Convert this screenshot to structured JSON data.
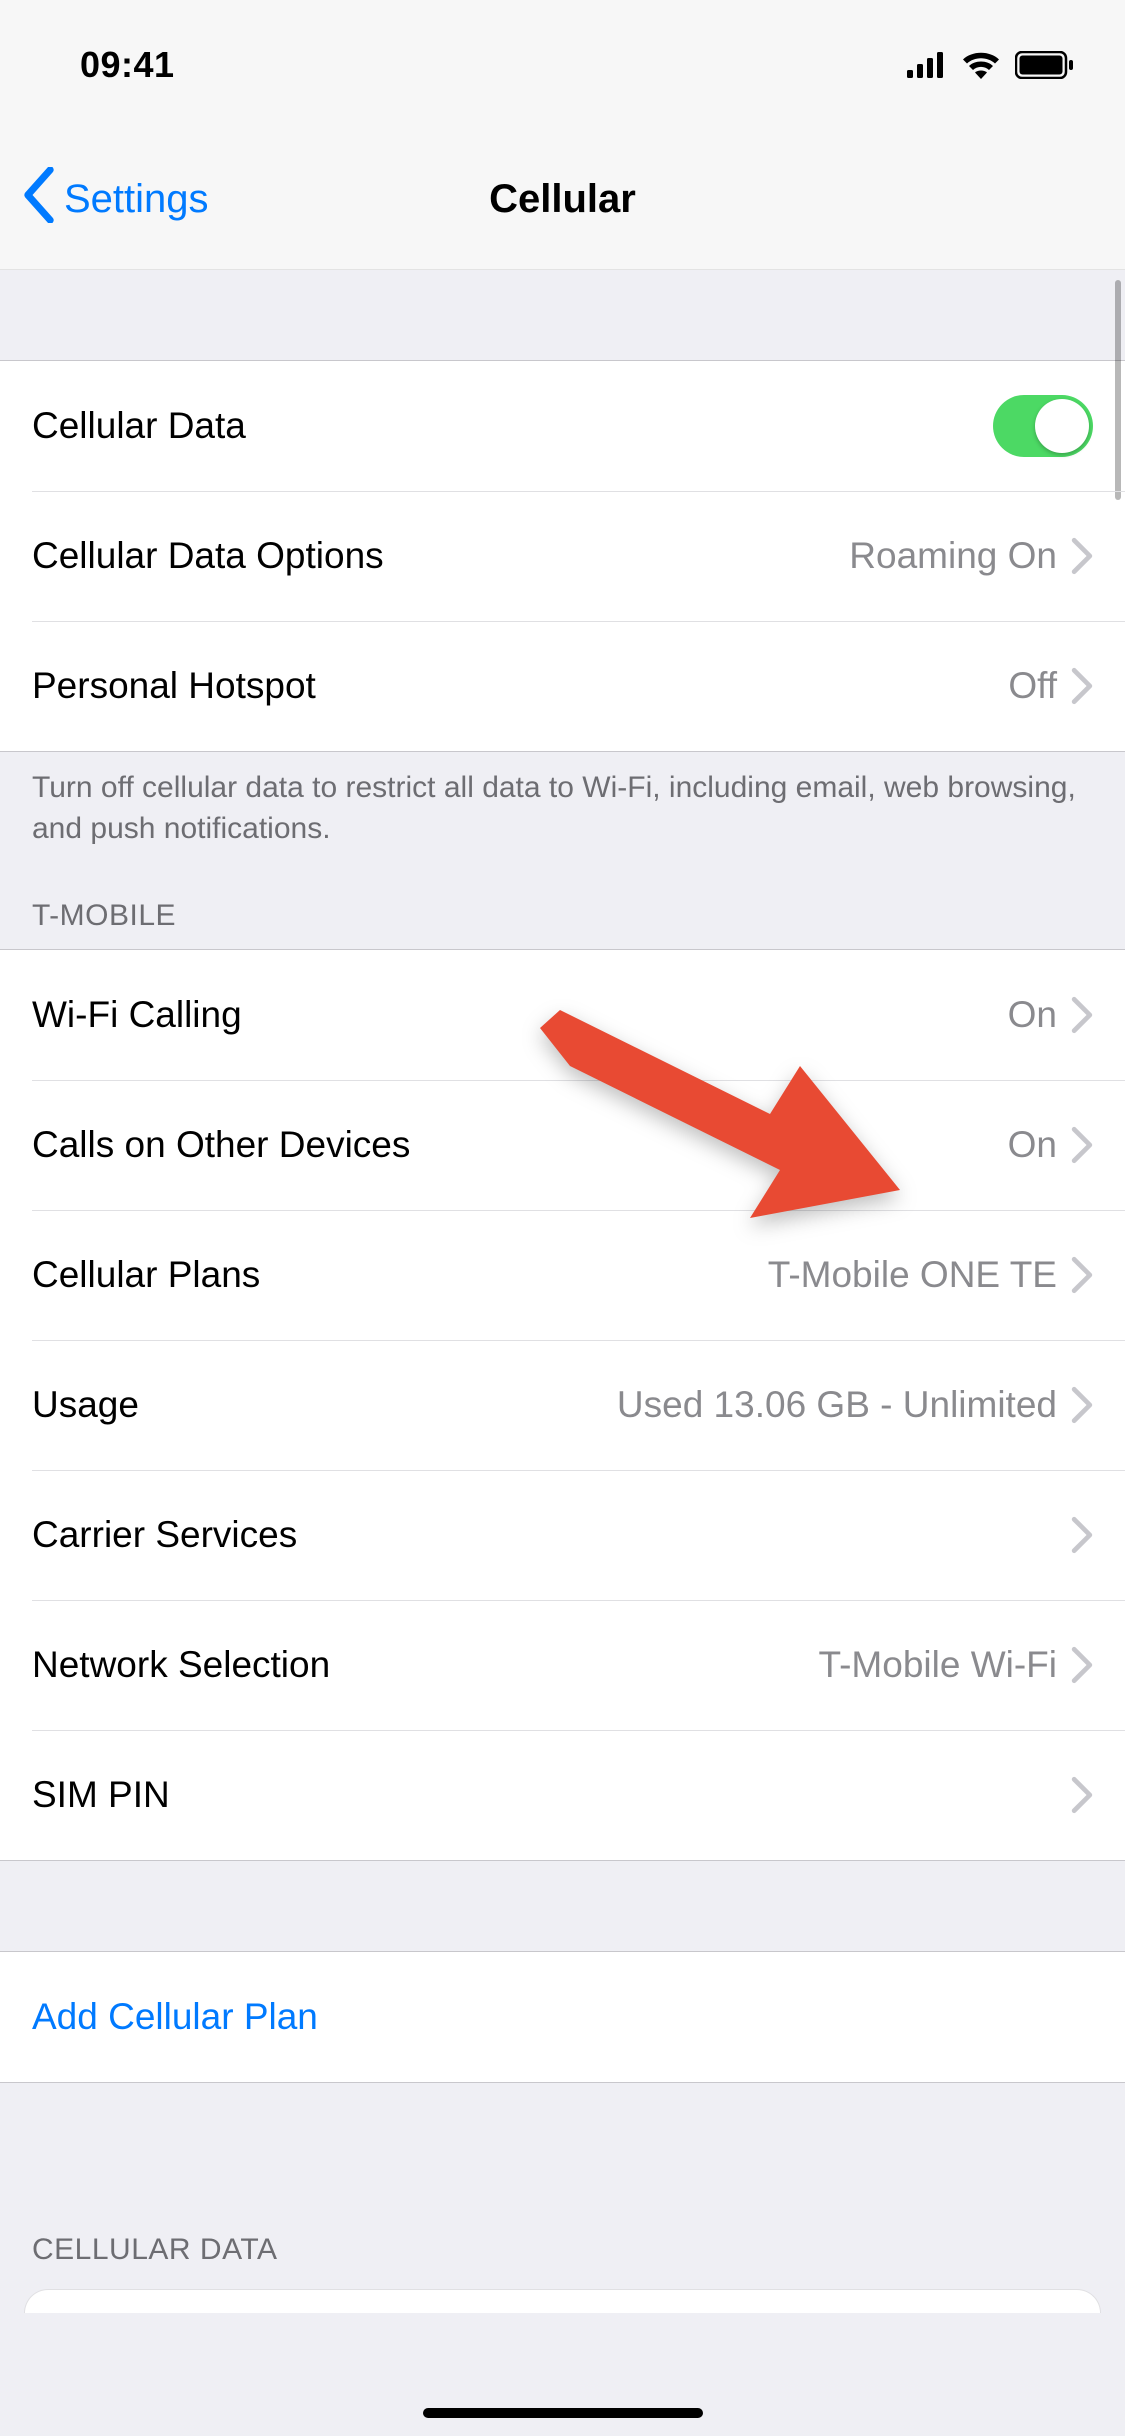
{
  "status": {
    "time": "09:41"
  },
  "nav": {
    "back": "Settings",
    "title": "Cellular"
  },
  "section1": {
    "cellular_data_label": "Cellular Data",
    "cellular_data_on": true,
    "options_label": "Cellular Data Options",
    "options_value": "Roaming On",
    "hotspot_label": "Personal Hotspot",
    "hotspot_value": "Off",
    "footer": "Turn off cellular data to restrict all data to Wi-Fi, including email, web browsing, and push notifications."
  },
  "section2": {
    "header": "T-MOBILE",
    "wifi_calling_label": "Wi-Fi Calling",
    "wifi_calling_value": "On",
    "calls_other_label": "Calls on Other Devices",
    "calls_other_value": "On",
    "plans_label": "Cellular Plans",
    "plans_value": "T-Mobile ONE TE",
    "usage_label": "Usage",
    "usage_value": "Used 13.06 GB - Unlimited",
    "carrier_label": "Carrier Services",
    "network_label": "Network Selection",
    "network_value": "T-Mobile Wi-Fi",
    "sim_pin_label": "SIM PIN"
  },
  "section3": {
    "add_plan_label": "Add Cellular Plan"
  },
  "section4": {
    "header": "CELLULAR DATA"
  },
  "annotation": {
    "arrow_color": "#e84a33"
  }
}
